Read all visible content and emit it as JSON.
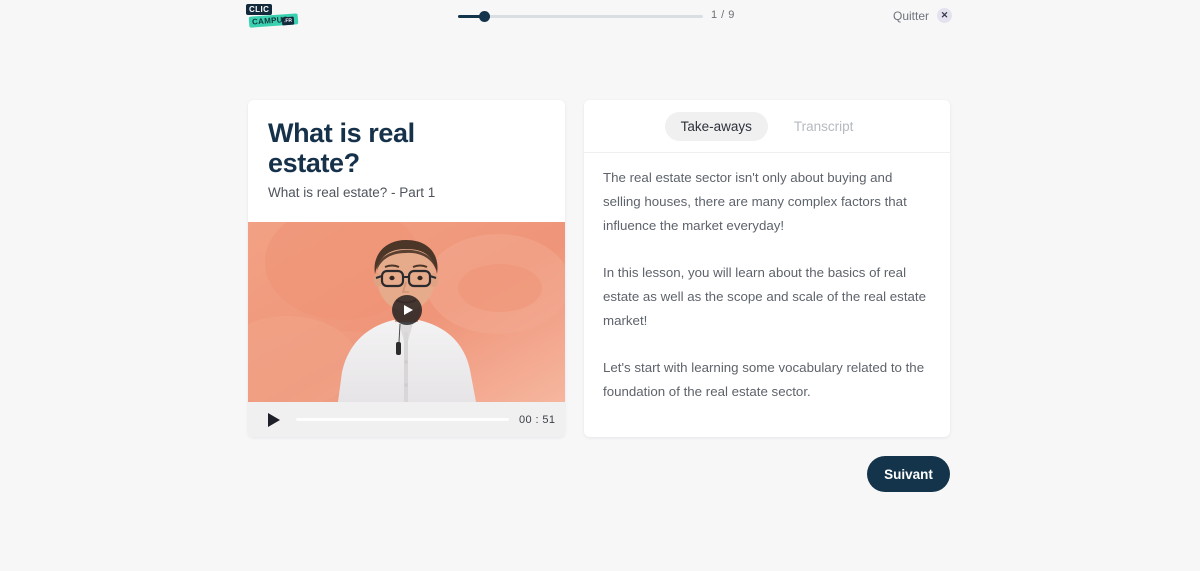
{
  "topbar": {
    "logo": {
      "line1": "CLIC",
      "line2": "CAMPUS",
      "badge": ".FR"
    },
    "progress": {
      "count_label": "1 / 9",
      "current": 1,
      "total": 9,
      "fill_color": "#13344b",
      "track_color": "#d9dee3"
    },
    "quit_label": "Quitter",
    "close_glyph": "✕"
  },
  "lesson": {
    "title": "What is real estate?",
    "subtitle": "What is real estate? - Part 1",
    "title_color": "#16314a"
  },
  "video": {
    "play_overlay_glyph": "▶",
    "background_colors": [
      "#f0a184",
      "#ec8f73",
      "#f5b29b"
    ],
    "controls": {
      "play_glyph": "▶",
      "time_label": "00 : 51",
      "progress_percent": 0
    }
  },
  "panel": {
    "tabs": [
      {
        "label": "Take-aways",
        "active": true
      },
      {
        "label": "Transcript",
        "active": false
      }
    ],
    "takeaways": [
      "The real estate sector isn't only about buying and selling houses, there are many complex factors that influence the market everyday!",
      "In this lesson, you will learn about the basics of real estate as well as the scope and scale of the real estate market!",
      "Let's start with learning some vocabulary related to the foundation of the real estate sector."
    ]
  },
  "footer": {
    "next_label": "Suivant",
    "next_color": "#13344b"
  }
}
